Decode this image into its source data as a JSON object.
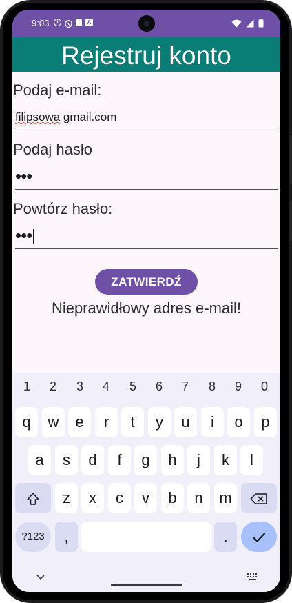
{
  "status": {
    "time": "9:03"
  },
  "app": {
    "title": "Rejestruj konto"
  },
  "form": {
    "email_label": "Podaj e-mail:",
    "email_value_word": "filipsowa",
    "email_value_rest": " gmail.com",
    "password_label": "Podaj hasło",
    "password_value": "•••",
    "repeat_label": "Powtórz hasło:",
    "repeat_value": "•••",
    "submit_label": "ZATWIERDŹ",
    "error_message": "Nieprawidłowy adres e-mail!"
  },
  "keyboard": {
    "numbers": [
      "1",
      "2",
      "3",
      "4",
      "5",
      "6",
      "7",
      "8",
      "9",
      "0"
    ],
    "row1": [
      "q",
      "w",
      "e",
      "r",
      "t",
      "y",
      "u",
      "i",
      "o",
      "p"
    ],
    "row2": [
      "a",
      "s",
      "d",
      "f",
      "g",
      "h",
      "j",
      "k",
      "l"
    ],
    "row3": [
      "z",
      "x",
      "c",
      "v",
      "b",
      "n",
      "m"
    ],
    "symbols_label": "?123",
    "comma": ",",
    "period": "."
  },
  "colors": {
    "statusbar": "#6e51a6",
    "appbar": "#0a7d77",
    "button": "#6e51a6",
    "background": "#fdf7fb",
    "enter_key": "#a8c0fb"
  }
}
